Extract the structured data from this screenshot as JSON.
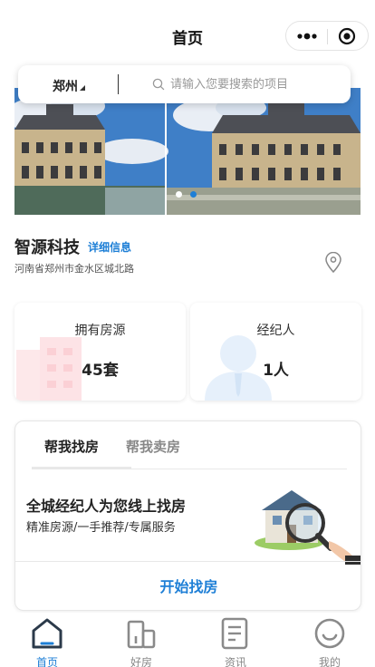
{
  "navbar": {
    "title": "首页",
    "capsule": {
      "more_icon": "more-dots-icon",
      "close_icon": "target-icon"
    }
  },
  "search": {
    "city": "郑州",
    "placeholder": "请输入您要搜索的项目",
    "search_icon": "search-icon"
  },
  "banner": {
    "slides": [
      "chateau-photo",
      "chateau-photo"
    ],
    "active_index": 1,
    "dot_active_color": "#1e7fd6",
    "dot_inactive_color": "#ffffff"
  },
  "company": {
    "name": "智源科技",
    "detail_link": "详细信息",
    "address": "河南省郑州市金水区城北路",
    "location_icon": "location-pin-icon"
  },
  "stats": [
    {
      "label": "拥有房源",
      "value": "45套",
      "icon": "building-icon"
    },
    {
      "label": "经纪人",
      "value": "1人",
      "icon": "agent-icon"
    }
  ],
  "find_card": {
    "tabs": [
      {
        "label": "帮我找房",
        "active": true
      },
      {
        "label": "帮我卖房",
        "active": false
      }
    ],
    "title": "全城经纪人为您线上找房",
    "subtitle": "精准房源/一手推荐/专属服务",
    "illustration": "magnifier-house-icon",
    "button": "开始找房"
  },
  "tabbar": {
    "items": [
      {
        "label": "首页",
        "icon": "home-icon",
        "active": true
      },
      {
        "label": "好房",
        "icon": "building-icon",
        "active": false
      },
      {
        "label": "资讯",
        "icon": "news-icon",
        "active": false
      },
      {
        "label": "我的",
        "icon": "smiley-icon",
        "active": false
      }
    ]
  },
  "colors": {
    "accent": "#1e7fd6",
    "text_primary": "#222222",
    "text_muted": "#888888"
  }
}
